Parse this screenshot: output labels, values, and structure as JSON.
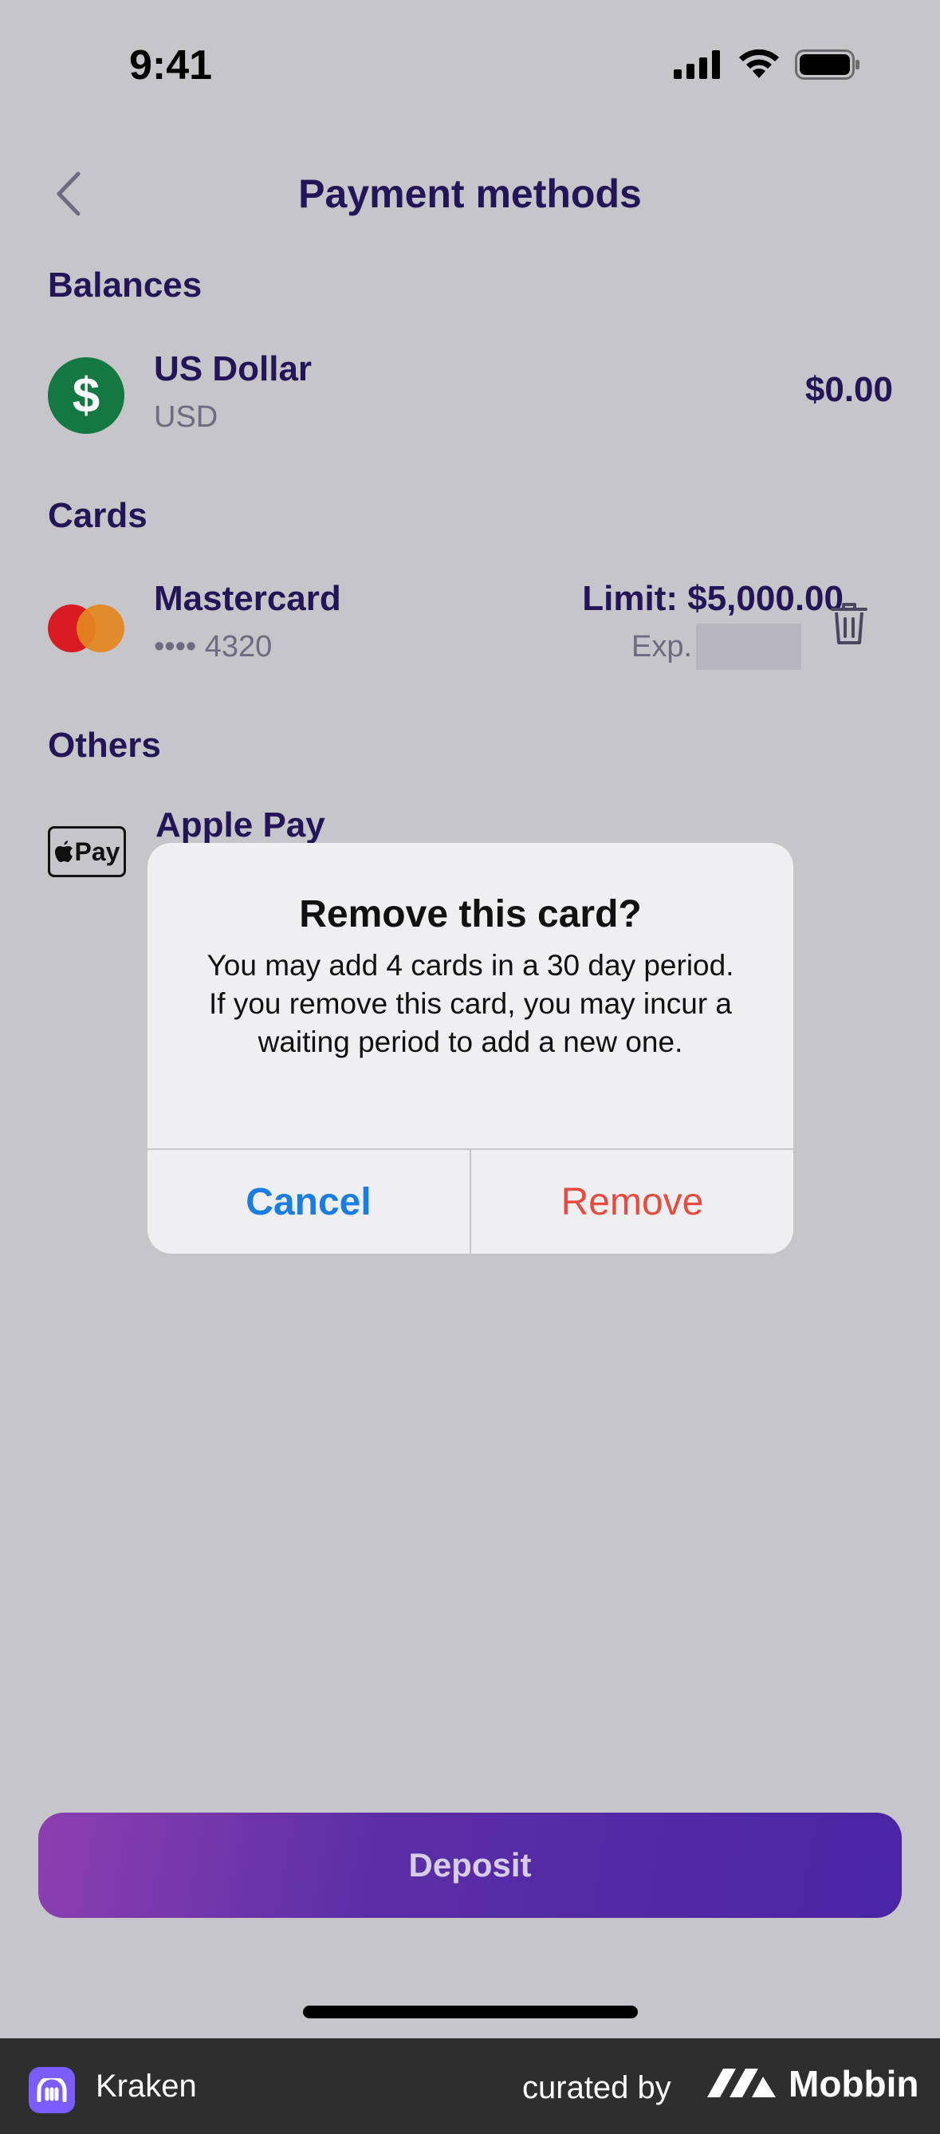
{
  "status_bar": {
    "time": "9:41"
  },
  "nav": {
    "title": "Payment methods"
  },
  "balances": {
    "heading": "Balances",
    "items": [
      {
        "title": "US Dollar",
        "subtitle": "USD",
        "amount": "$0.00",
        "icon": "dollar-icon"
      }
    ]
  },
  "cards": {
    "heading": "Cards",
    "items": [
      {
        "title": "Mastercard",
        "subtitle": "•••• 4320",
        "limit": "Limit: $5,000.00",
        "exp_label": "Exp.",
        "icon": "mastercard-icon"
      }
    ]
  },
  "others": {
    "heading": "Others",
    "items": [
      {
        "title": "Apple Pay",
        "badge": "Pay",
        "icon": "apple-pay-icon"
      }
    ]
  },
  "dialog": {
    "title": "Remove this card?",
    "message": "You may add 4 cards in a 30 day period. If you remove this card, you may incur a waiting period to add a new one.",
    "cancel_label": "Cancel",
    "remove_label": "Remove"
  },
  "deposit": {
    "label": "Deposit"
  },
  "footer": {
    "app_name": "Kraken",
    "curated_by": "curated by",
    "brand": "Mobbin"
  },
  "colors": {
    "overlay_bg": "#c6c5ca",
    "text_primary": "#231558",
    "cancel_blue": "#1a7de3",
    "remove_red": "#e94a3f",
    "usd_green": "#147842"
  }
}
